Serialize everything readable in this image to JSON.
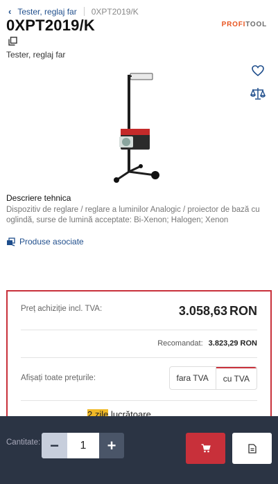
{
  "breadcrumb": {
    "parent": "Tester, reglaj far",
    "current": "0XPT2019/K"
  },
  "product": {
    "code": "0XPT2019/K",
    "subtitle": "Tester, reglaj far",
    "image_alt": "headlight tester device"
  },
  "brand": {
    "part1": "PROFI",
    "part2": "TOOL",
    "color1": "#e8541f",
    "color2": "#6b6b6b"
  },
  "description": {
    "title": "Descriere tehnica",
    "text": "Dispozitiv de reglare / reglare a luminilor Analogic / proiector de bază cu oglindă, surse de lumină acceptate: Bi-Xenon; Halogen; Xenon"
  },
  "associated": {
    "label": "Produse asociate"
  },
  "pricing": {
    "purchase_label": "Preț achiziție incl. TVA:",
    "purchase_value": "3.058,63",
    "currency": "RON",
    "recommended_label": "Recomandat:",
    "recommended_value": "3.823,29 RON",
    "show_prices_label": "Afișați toate prețurile:",
    "toggle": {
      "without_vat": "fara TVA",
      "with_vat": "cu TVA",
      "selected": "cu TVA"
    }
  },
  "delivery": {
    "highlight": "2 zile",
    "rest": "lucrătoare"
  },
  "bottom_bar": {
    "quantity_label": "Cantitate:",
    "quantity_value": "1",
    "minus": "−",
    "plus": "+"
  },
  "icons": {
    "back": "chevron-left-icon",
    "copy": "copy-icon",
    "favorite": "heart-icon",
    "compare": "scale-icon",
    "associated": "linked-products-icon",
    "cart": "cart-icon",
    "document": "document-icon"
  },
  "colors": {
    "accent_red": "#c8303a",
    "link_blue": "#1f4e8c",
    "bottom_bar": "#2b3444",
    "highlight": "#f0b928"
  }
}
